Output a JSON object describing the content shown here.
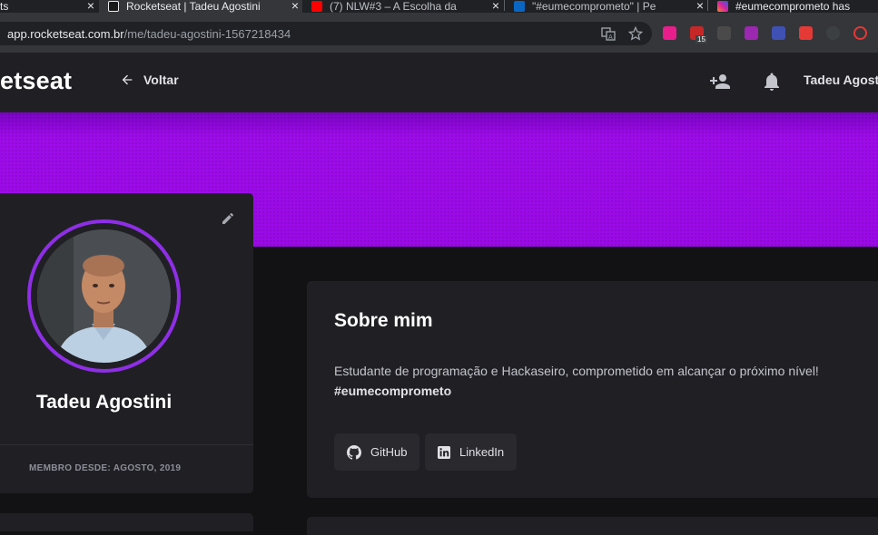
{
  "browser": {
    "tabs": [
      {
        "title": "ts",
        "active": false
      },
      {
        "title": "Rocketseat | Tadeu Agostini",
        "active": true
      },
      {
        "title": "(7) NLW#3 – A Escolha da",
        "active": false
      },
      {
        "title": "\"#eumecomprometo\" | Pe",
        "active": false
      },
      {
        "title": "#eumecomprometo has",
        "active": false
      }
    ],
    "close_glyph": "×",
    "url_host": "app.rocketseat.com.br",
    "url_path": "/me/tadeu-agostini-1567218434",
    "extension_badge": "15",
    "colors": {
      "youtube": "#ff0000",
      "linkedin": "#0a66c2",
      "instagram": "#d6249f"
    }
  },
  "header": {
    "logo": "etseat",
    "back_label": "Voltar",
    "user_name": "Tadeu Agostini",
    "icons": [
      "add-person-icon",
      "bell-icon",
      "arrow-left-icon"
    ]
  },
  "profile": {
    "name": "Tadeu Agostini",
    "member_since": "MEMBRO DESDE: AGOSTO, 2019",
    "ring_color": "#8e2ee6"
  },
  "about": {
    "title": "Sobre mim",
    "bio": "Estudante de programação e Hackaseiro, comprometido em alcançar o próximo nível!",
    "hashtag": "#eumecomprometo",
    "links": {
      "github": "GitHub",
      "linkedin": "LinkedIn"
    }
  },
  "colors": {
    "accent": "#9a0ae6",
    "background": "#121214",
    "card": "#202024"
  }
}
